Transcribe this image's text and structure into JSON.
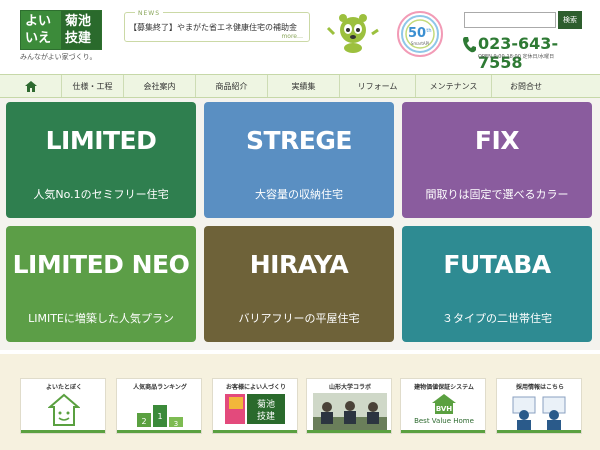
{
  "header": {
    "logo": {
      "left": "よい\nいえ",
      "right": "菊池\n技建"
    },
    "tagline": "みんながよい家づくり。",
    "news": {
      "label": "NEWS",
      "text": "【募集終了】やまがた省エネ健康住宅の補助金",
      "more": "more…"
    },
    "badge": {
      "number": "50",
      "suffix": "th",
      "sub": "SmartAPI"
    },
    "search": {
      "placeholder": "",
      "button": "検索"
    },
    "phone": "023-643-7558",
    "hours": "OPEN 9:00-18:00 定休日/水曜日"
  },
  "nav": {
    "items": [
      "仕様・工程",
      "会社案内",
      "商品紹介",
      "実績集",
      "リフォーム",
      "メンテナンス",
      "お問合せ"
    ]
  },
  "tiles": [
    {
      "name": "LIMITED",
      "desc": "人気No.1のセミフリー住宅"
    },
    {
      "name": "STREGE",
      "desc": "大容量の収納住宅"
    },
    {
      "name": "FIX",
      "desc": "間取りは固定で選べるカラー"
    },
    {
      "name": "LIMITED NEO",
      "desc": "LIMITEに増築した人気プラン"
    },
    {
      "name": "HIRAYA",
      "desc": "バリアフリーの平屋住宅"
    },
    {
      "name": "FUTABA",
      "desc": "３タイプの二世帯住宅"
    }
  ],
  "banners": [
    {
      "title": "よいたとぼく"
    },
    {
      "title": "人気商品ランキング"
    },
    {
      "title": "お客様によい人づくり"
    },
    {
      "title": "山形大学コラボ"
    },
    {
      "title": "建物価値保証システム",
      "sub": "Best Value Home"
    },
    {
      "title": "採用情報はこちら"
    }
  ],
  "colors": {
    "brand_green": "#2e7a34",
    "tile_limited": "#2f7f4f",
    "tile_strege": "#5a8fc2",
    "tile_fix": "#8a5c9e",
    "tile_limited_neo": "#5c9e47",
    "tile_hiraya": "#6e6239",
    "tile_futaba": "#2e8b92"
  }
}
